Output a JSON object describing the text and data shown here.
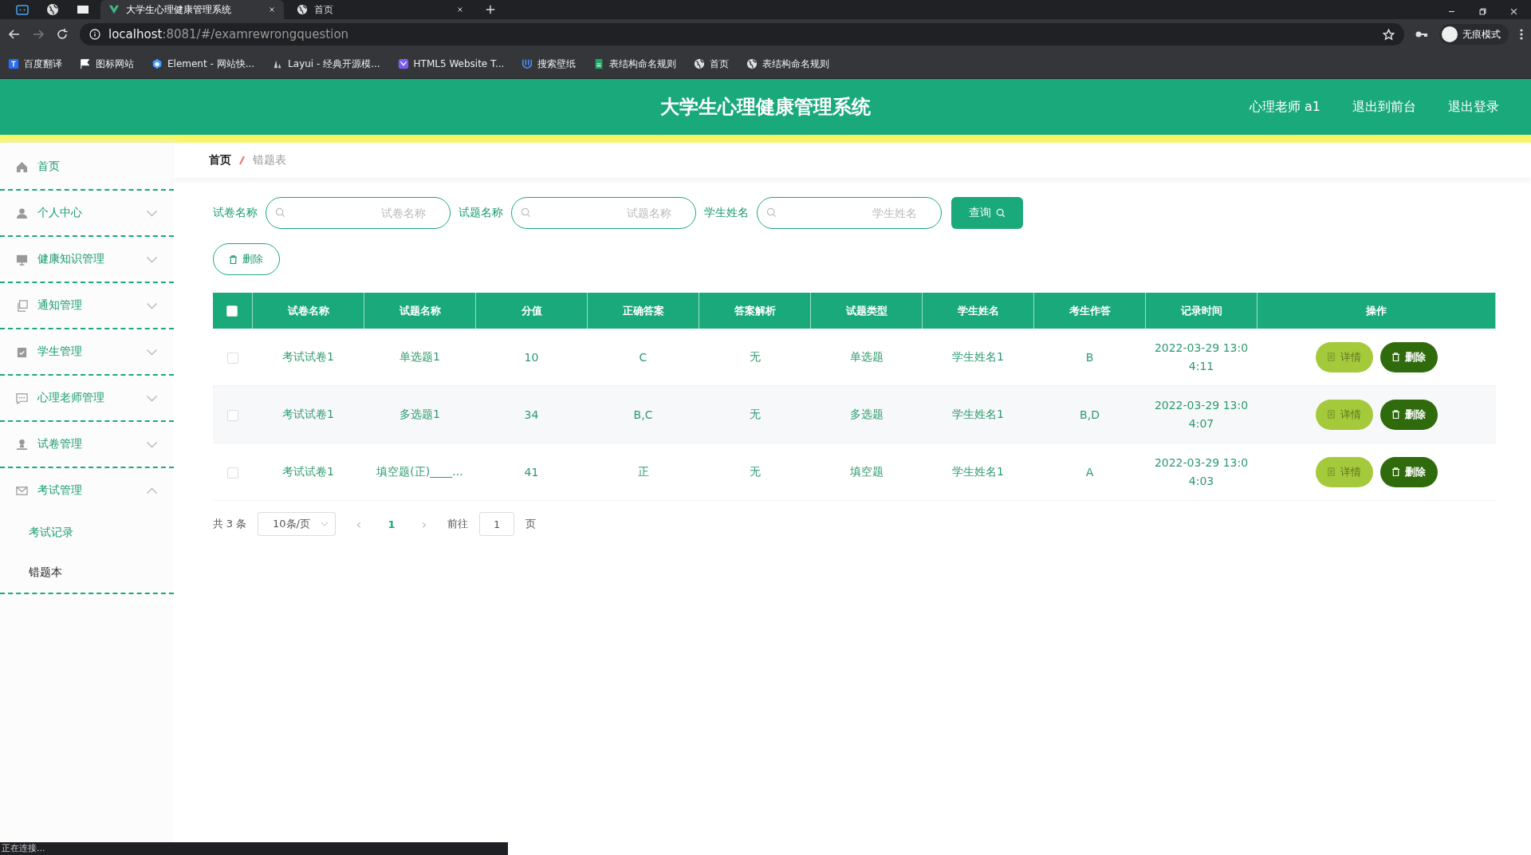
{
  "browser": {
    "tabs": [
      {
        "title": "大学生心理健康管理系统",
        "selected": true
      },
      {
        "title": "首页",
        "selected": false
      }
    ],
    "url_host": "localhost",
    "url_rest": ":8081/#/examrewrongquestion",
    "bookmarks": [
      {
        "label": "百度翻译"
      },
      {
        "label": "图标网站"
      },
      {
        "label": "Element - 网站快..."
      },
      {
        "label": "Layui - 经典开源模..."
      },
      {
        "label": "HTML5 Website T..."
      },
      {
        "label": "搜索壁纸"
      },
      {
        "label": "表结构命名规则"
      },
      {
        "label": "首页"
      },
      {
        "label": "表结构命名规则"
      }
    ],
    "profile": "无痕模式"
  },
  "header": {
    "title": "大学生心理健康管理系统",
    "links": [
      "心理老师 a1",
      "退出到前台",
      "退出登录"
    ]
  },
  "sidebar": {
    "items": [
      {
        "label": "首页",
        "expandable": false,
        "expanded": false
      },
      {
        "label": "个人中心",
        "expandable": true,
        "expanded": false
      },
      {
        "label": "健康知识管理",
        "expandable": true,
        "expanded": false
      },
      {
        "label": "通知管理",
        "expandable": true,
        "expanded": false
      },
      {
        "label": "学生管理",
        "expandable": true,
        "expanded": false
      },
      {
        "label": "心理老师管理",
        "expandable": true,
        "expanded": false
      },
      {
        "label": "试卷管理",
        "expandable": true,
        "expanded": false
      },
      {
        "label": "考试管理",
        "expandable": true,
        "expanded": true,
        "children": [
          {
            "label": "考试记录",
            "selected": false
          },
          {
            "label": "错题本",
            "selected": true
          }
        ]
      }
    ]
  },
  "breadcrumb": [
    "首页",
    "错题表"
  ],
  "filters": [
    {
      "label": "试卷名称",
      "placeholder": "试卷名称"
    },
    {
      "label": "试题名称",
      "placeholder": "试题名称"
    },
    {
      "label": "学生姓名",
      "placeholder": "学生姓名"
    }
  ],
  "query_button": "查询",
  "delete_button": "删除",
  "table": {
    "all_checked": false,
    "columns": [
      "试卷名称",
      "试题名称",
      "分值",
      "正确答案",
      "答案解析",
      "试题类型",
      "学生姓名",
      "考生作答",
      "记录时间",
      "操作"
    ],
    "rows": [
      {
        "checked": false,
        "cells": [
          "考试试卷1",
          "单选题1",
          "10",
          "C",
          "无",
          "单选题",
          "学生姓名1",
          "B",
          "2022-03-29 13:04:11"
        ],
        "actions": [
          "详情",
          "删除"
        ]
      },
      {
        "checked": false,
        "cells": [
          "考试试卷1",
          "多选题1",
          "34",
          "B,C",
          "无",
          "多选题",
          "学生姓名1",
          "B,D",
          "2022-03-29 13:04:07"
        ],
        "actions": [
          "详情",
          "删除"
        ]
      },
      {
        "checked": false,
        "cells": [
          "考试试卷1",
          "填空题(正)____...",
          "41",
          "正",
          "无",
          "填空题",
          "学生姓名1",
          "A",
          "2022-03-29 13:04:03"
        ],
        "actions": [
          "详情",
          "删除"
        ]
      }
    ]
  },
  "pagination": {
    "total": "共 3 条",
    "page_size": "10条/页",
    "prev": "‹",
    "pages": [
      {
        "label": "1",
        "selected": true
      }
    ],
    "next": "›",
    "goto_label": "前往",
    "goto_value": "1",
    "goto_suffix": "页"
  },
  "status_bar": "正在连接..."
}
